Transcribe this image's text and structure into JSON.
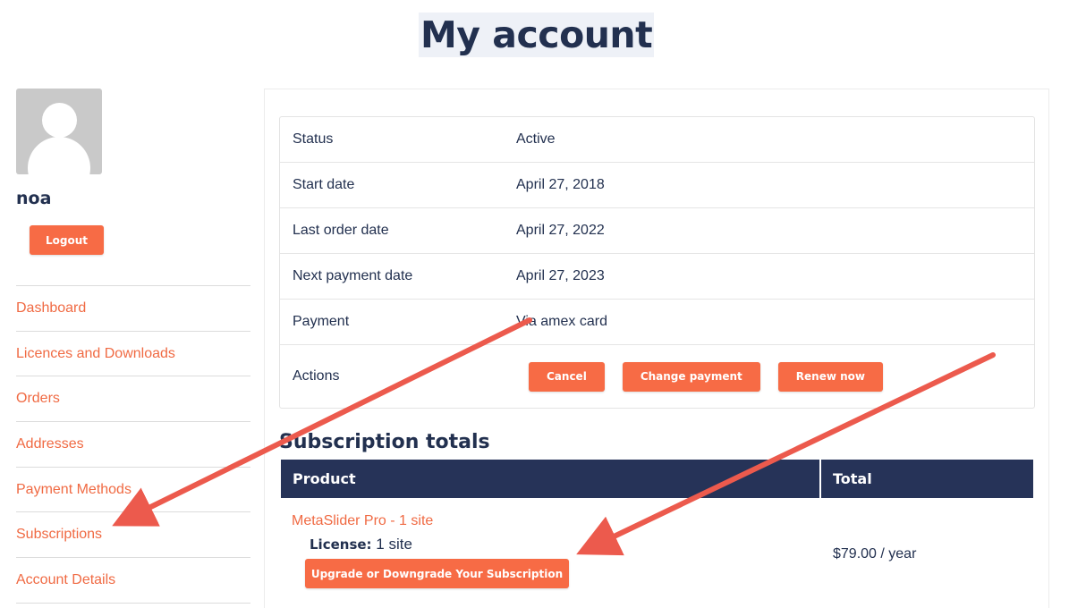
{
  "page": {
    "title": "My account"
  },
  "user": {
    "name": "noa",
    "logout_label": "Logout"
  },
  "nav": {
    "items": [
      {
        "label": "Dashboard"
      },
      {
        "label": "Licences and Downloads"
      },
      {
        "label": "Orders"
      },
      {
        "label": "Addresses"
      },
      {
        "label": "Payment Methods"
      },
      {
        "label": "Subscriptions"
      },
      {
        "label": "Account Details"
      }
    ]
  },
  "subscription": {
    "rows": [
      {
        "key": "Status",
        "value": "Active"
      },
      {
        "key": "Start date",
        "value": "April 27, 2018"
      },
      {
        "key": "Last order date",
        "value": "April 27, 2022"
      },
      {
        "key": "Next payment date",
        "value": "April 27, 2023"
      },
      {
        "key": "Payment",
        "value": "Via amex card"
      }
    ],
    "actions_label": "Actions",
    "actions": {
      "cancel": "Cancel",
      "change_payment": "Change payment",
      "renew": "Renew now"
    }
  },
  "totals": {
    "title": "Subscription totals",
    "col_product": "Product",
    "col_total": "Total",
    "product_name": "MetaSlider Pro - 1 site",
    "license_label": "License:",
    "license_value": "1 site",
    "upgrade_label": "Upgrade or Downgrade Your Subscription",
    "total_value": "$79.00 / year"
  },
  "colors": {
    "accent": "#f76b45",
    "navy": "#263358",
    "arrow": "#ec5a4d"
  }
}
